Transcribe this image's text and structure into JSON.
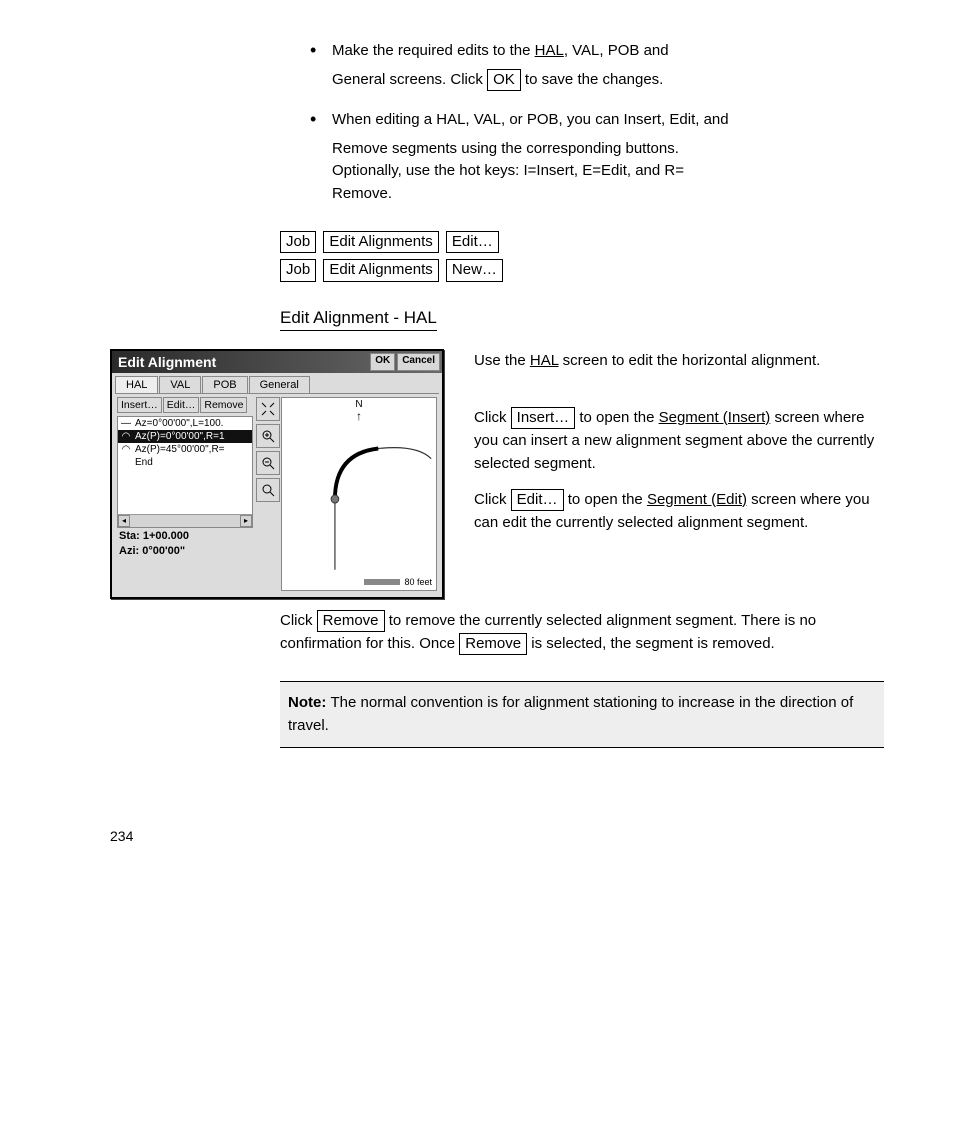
{
  "bullets": {
    "b1_a": "Make the required edits to the ",
    "b1_link": "HAL",
    "b1_b": ", VAL, POB and",
    "b1_c": "General screens. Click ",
    "b1_ok": "OK",
    "b1_d": " to save the changes.",
    "b2_a": "When editing a HAL, VAL, or POB, you can Insert, Edit, and",
    "b2_b": "Remove segments using the corresponding buttons.",
    "b2_c": "Optionally, use the hot keys: I=Insert, E=Edit, and R=",
    "b2_d": "Remove."
  },
  "paths": {
    "job": "Job",
    "editAlign": "Edit Alignments",
    "edit": "Edit…",
    "neww": "New…"
  },
  "heading": "Edit Alignment - HAL",
  "intro_a": "Use the ",
  "intro_link": "HAL",
  "intro_b": " screen to edit the horizontal alignment.",
  "insert_a": "Click ",
  "insert_btn": "Insert…",
  "insert_b": " to open the ",
  "insert_link": "Segment (Insert)",
  "insert_c": " screen where you can insert a new alignment segment above the currently selected segment.",
  "edit_a": "Click ",
  "edit_btn": "Edit…",
  "edit_b": " to open the ",
  "edit_link": "Segment (Edit)",
  "edit_c": " screen where you can edit the currently selected alignment segment.",
  "remove_a": "Click ",
  "remove_btn": "Remove",
  "remove_b": " to remove the currently selected alignment segment. There is no confirmation for this. Once ",
  "remove_c": " is selected, the segment is removed.",
  "note_a": "Note: ",
  "note_b": "The normal convention is for alignment stationing to increase in the direction of travel.",
  "page_no": "234",
  "dialog": {
    "title": "Edit Alignment",
    "ok": "OK",
    "cancel": "Cancel",
    "tabs": {
      "hal": "HAL",
      "val": "VAL",
      "pob": "POB",
      "general": "General"
    },
    "btns": {
      "insert": "Insert…",
      "edit": "Edit…",
      "remove": "Remove"
    },
    "rows": {
      "r1": "Az=0°00'00\",L=100.",
      "r2": "Az(P)=0°00'00\",R=1",
      "r3": "Az(P)=45°00'00\",R=",
      "r4": "End"
    },
    "sta": "Sta: 1+00.000",
    "azi": "Azi: 0°00'00\"",
    "north": "N",
    "scale": "80 feet"
  }
}
